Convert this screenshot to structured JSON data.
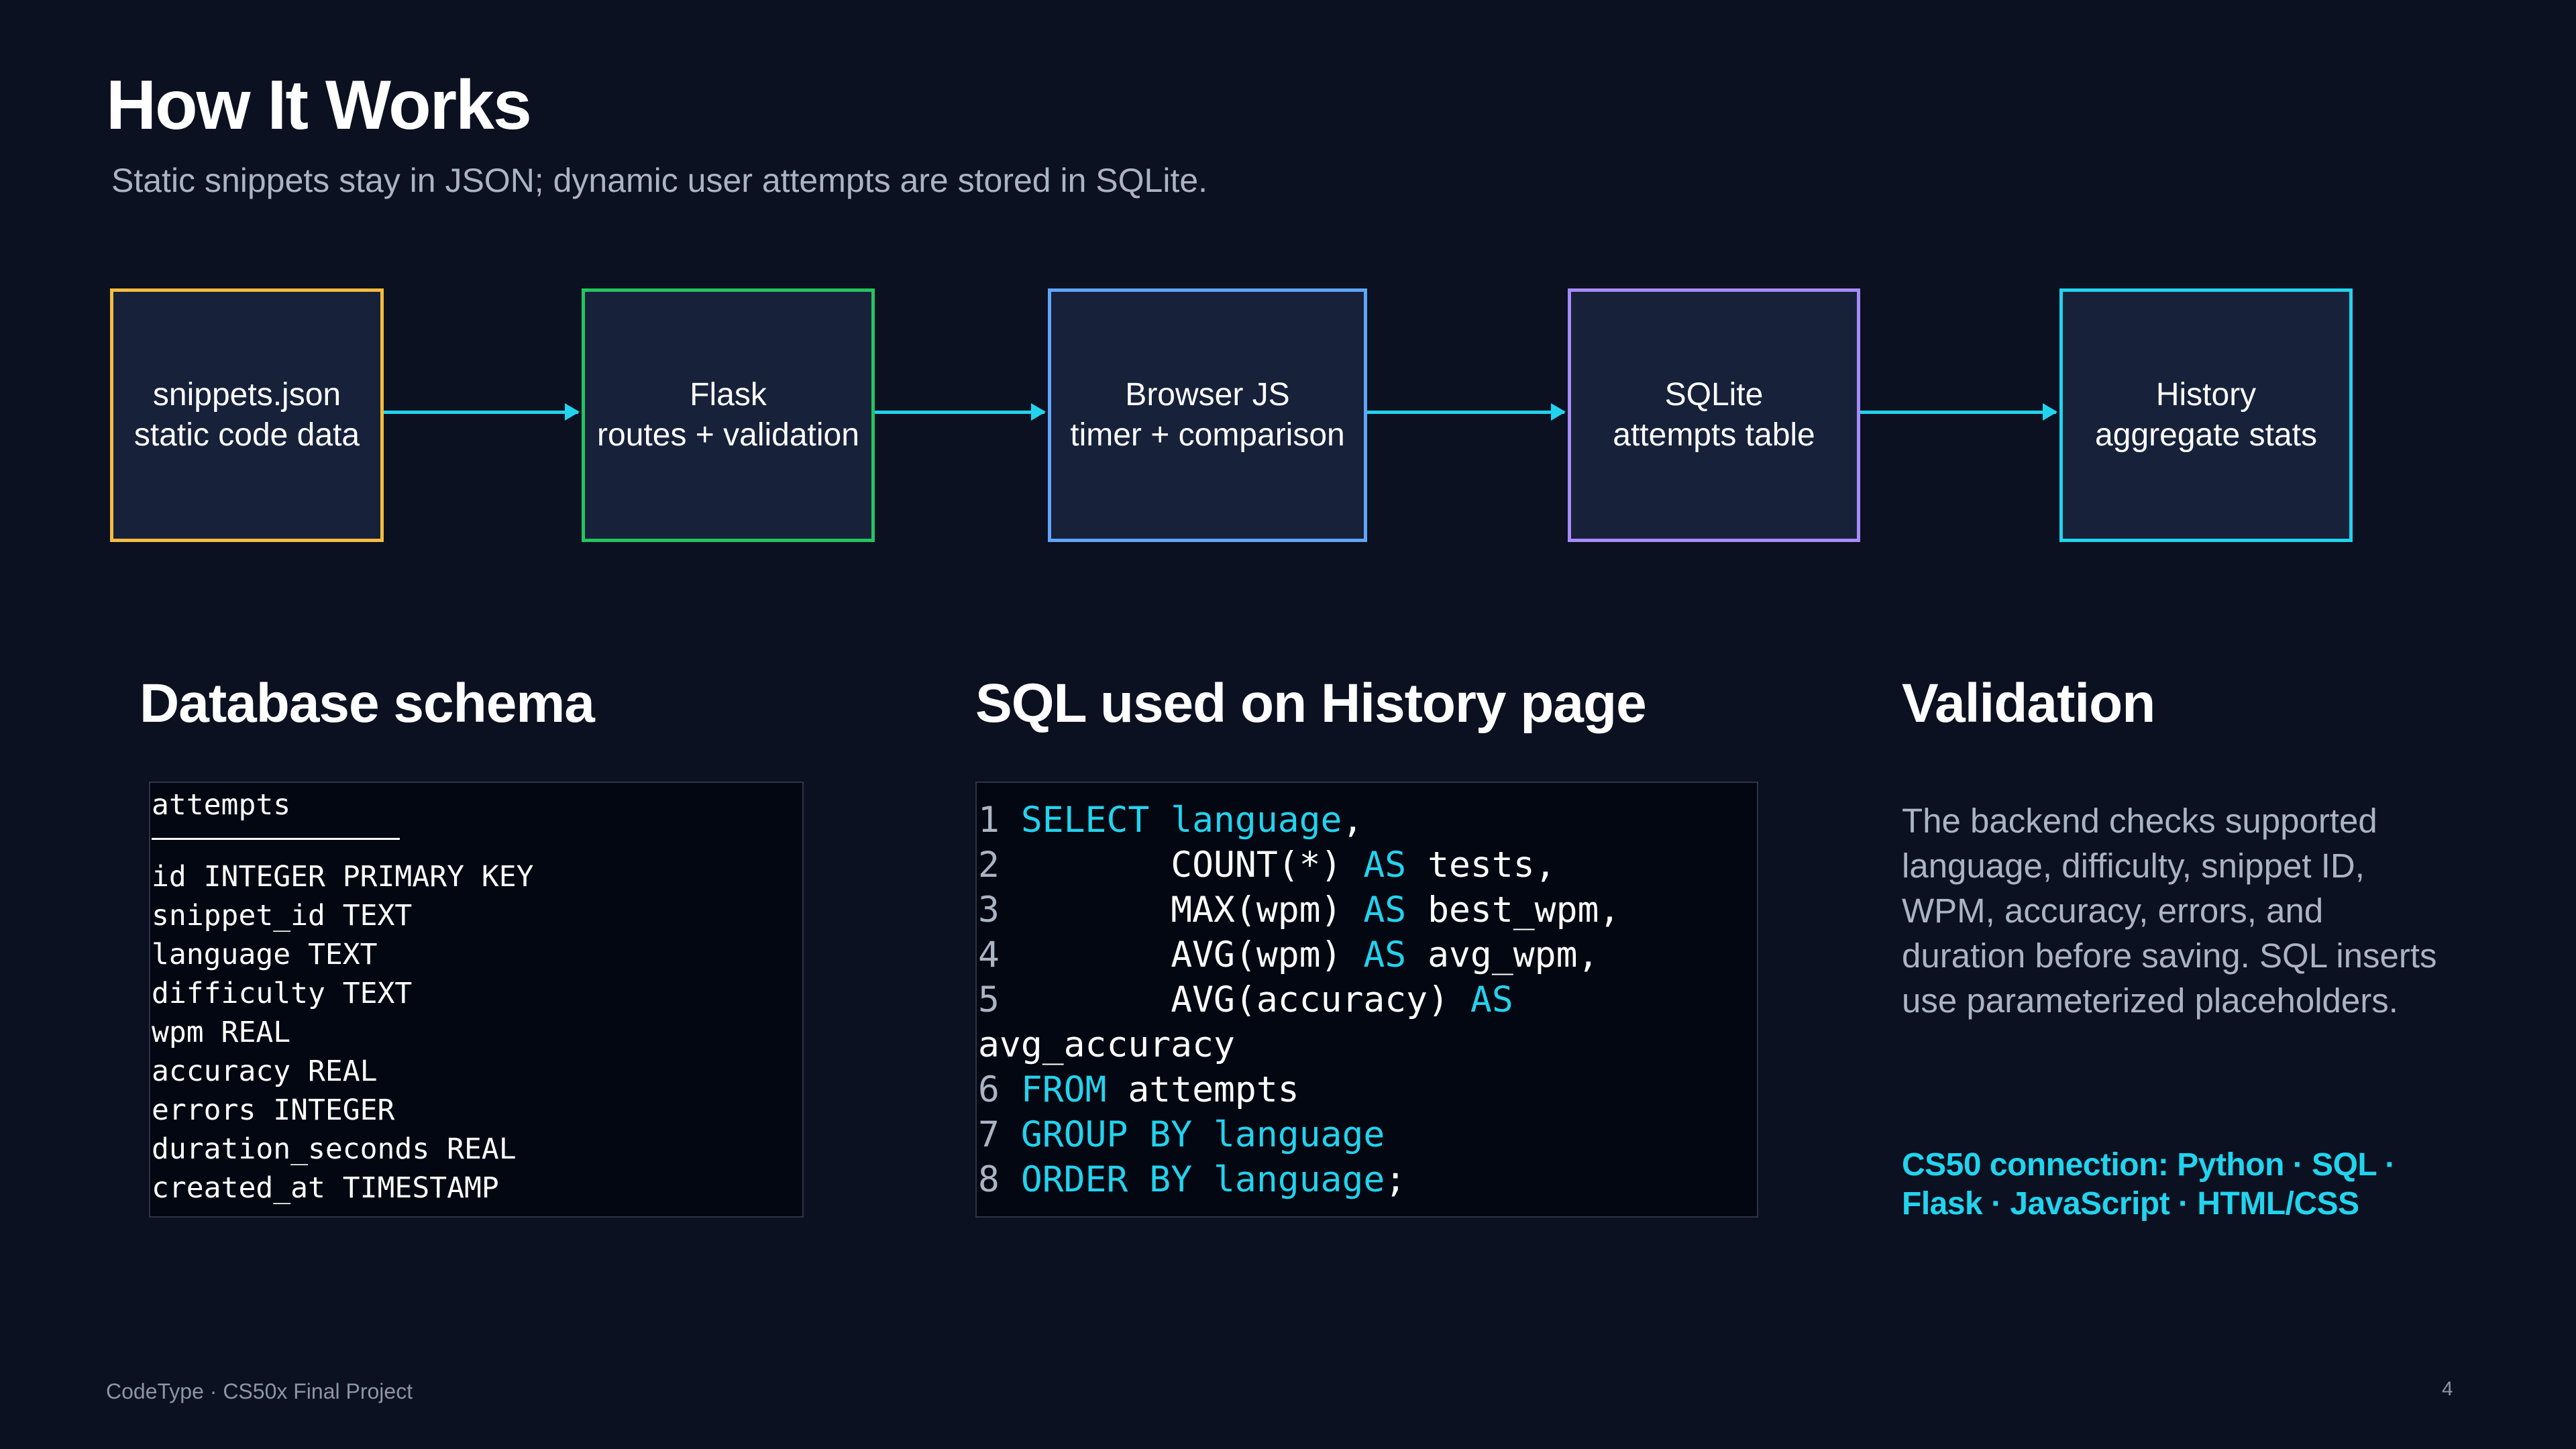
{
  "slide": {
    "title": "How It Works",
    "subtitle": "Static snippets stay in JSON; dynamic user attempts are stored in SQLite."
  },
  "flow": {
    "colors": [
      "#f5bd3f",
      "#22c55e",
      "#60a5fa",
      "#a78bfa",
      "#22d3ee"
    ],
    "arrow_color": "#22d3ee",
    "boxes": [
      {
        "title": "snippets.json",
        "subtitle": "static code data"
      },
      {
        "title": "Flask",
        "subtitle": "routes + validation"
      },
      {
        "title": "Browser JS",
        "subtitle": "timer + comparison"
      },
      {
        "title": "SQLite",
        "subtitle": "attempts table"
      },
      {
        "title": "History",
        "subtitle": "aggregate stats"
      }
    ]
  },
  "schema": {
    "heading": "Database schema",
    "table_name": "attempts",
    "columns": [
      "id INTEGER PRIMARY KEY",
      "snippet_id TEXT",
      "language TEXT",
      "difficulty TEXT",
      "wpm REAL",
      "accuracy REAL",
      "errors INTEGER",
      "duration_seconds REAL",
      "created_at TIMESTAMP"
    ]
  },
  "sql": {
    "heading": "SQL used on History page",
    "lines": [
      [
        {
          "t": "1 ",
          "c": "ln"
        },
        {
          "t": "SELECT language",
          "c": "kw"
        },
        {
          "t": ",",
          "c": ""
        }
      ],
      [
        {
          "t": "2 ",
          "c": "ln"
        },
        {
          "t": "       COUNT(*) ",
          "c": ""
        },
        {
          "t": "AS",
          "c": "kw"
        },
        {
          "t": " tests,",
          "c": ""
        }
      ],
      [
        {
          "t": "3 ",
          "c": "ln"
        },
        {
          "t": "       MAX(wpm) ",
          "c": ""
        },
        {
          "t": "AS",
          "c": "kw"
        },
        {
          "t": " best_wpm,",
          "c": ""
        }
      ],
      [
        {
          "t": "4 ",
          "c": "ln"
        },
        {
          "t": "       AVG(wpm) ",
          "c": ""
        },
        {
          "t": "AS",
          "c": "kw"
        },
        {
          "t": " avg_wpm,",
          "c": ""
        }
      ],
      [
        {
          "t": "5 ",
          "c": "ln"
        },
        {
          "t": "       AVG(accuracy) ",
          "c": ""
        },
        {
          "t": "AS",
          "c": "kw"
        }
      ],
      [
        {
          "t": "avg_accuracy",
          "c": ""
        }
      ],
      [
        {
          "t": "6 ",
          "c": "ln"
        },
        {
          "t": "FROM",
          "c": "kw"
        },
        {
          "t": " attempts",
          "c": ""
        }
      ],
      [
        {
          "t": "7 ",
          "c": "ln"
        },
        {
          "t": "GROUP BY language",
          "c": "kw"
        }
      ],
      [
        {
          "t": "8 ",
          "c": "ln"
        },
        {
          "t": "ORDER BY language",
          "c": "kw"
        },
        {
          "t": ";",
          "c": ""
        }
      ]
    ]
  },
  "validation": {
    "heading": "Validation",
    "body": "The backend checks supported language, difficulty, snippet ID, WPM, accuracy, errors, and duration before saving. SQL inserts use parameterized placeholders.",
    "cs50": "CS50 connection: Python · SQL · Flask · JavaScript · HTML/CSS"
  },
  "footer": {
    "left": "CodeType · CS50x Final Project",
    "page": "4"
  }
}
